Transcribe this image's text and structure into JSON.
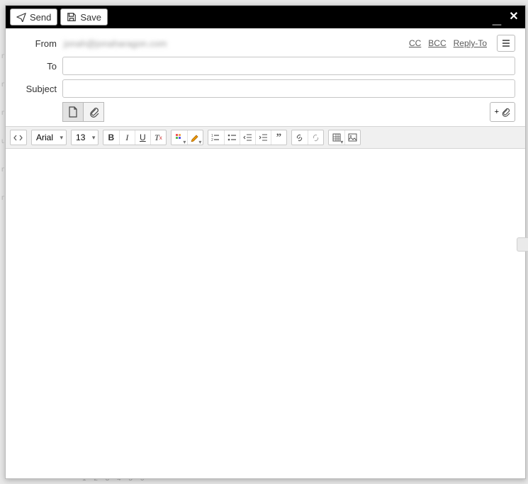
{
  "titlebar": {
    "send_label": "Send",
    "save_label": "Save"
  },
  "fields": {
    "from_label": "From",
    "from_value": "jonah@jonaharagon.com",
    "to_label": "To",
    "to_value": "",
    "subject_label": "Subject",
    "subject_value": ""
  },
  "links": {
    "cc": "CC",
    "bcc": "BCC",
    "reply_to": "Reply-To"
  },
  "toolbar": {
    "font_family": "Arial",
    "font_size": "13"
  },
  "background": {
    "pager": "1 2 3 4 5 6"
  }
}
